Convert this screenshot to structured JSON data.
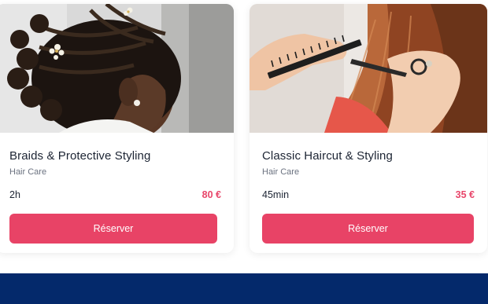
{
  "services": [
    {
      "title": "Braids & Protective Styling",
      "category": "Hair Care",
      "duration": "2h",
      "price": "80 €",
      "button_label": "Réserver"
    },
    {
      "title": "Classic Haircut & Styling",
      "category": "Hair Care",
      "duration": "45min",
      "price": "35 €",
      "button_label": "Réserver"
    }
  ],
  "colors": {
    "accent": "#e84366",
    "price": "#e8466a",
    "footer": "#04296b",
    "title_text": "#1c2433",
    "muted_text": "#6b7280"
  }
}
